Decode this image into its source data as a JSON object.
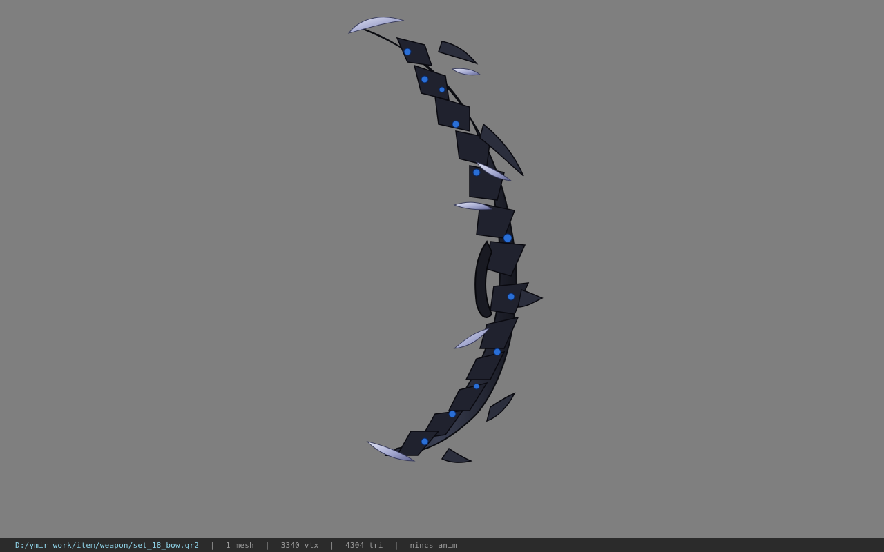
{
  "viewport": {
    "background": "#7f7f7f",
    "model_name": "bow-model"
  },
  "statusbar": {
    "file_path": "D:/ymir work/item/weapon/set_18_bow.gr2",
    "separator": "|",
    "mesh_count": "1 mesh",
    "vertex_count": "3340 vtx",
    "triangle_count": "4304 tri",
    "anim_status": "nincs anim",
    "path_color": "#8fd3e8"
  }
}
